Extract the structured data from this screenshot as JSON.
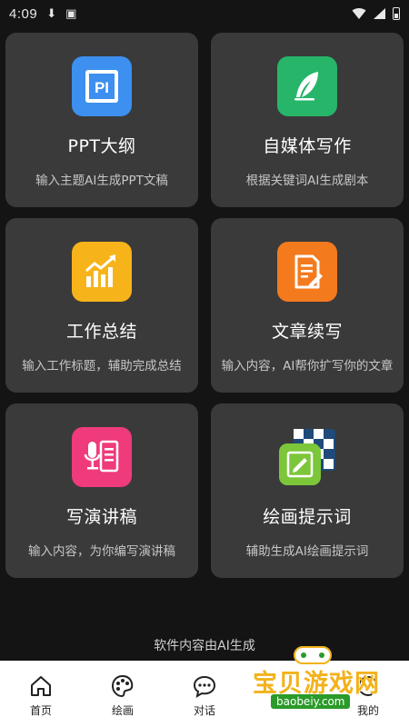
{
  "status_bar": {
    "time": "4:09"
  },
  "cards": [
    {
      "title": "PPT大纲",
      "subtitle": "输入主题AI生成PPT文稿",
      "icon": "ppt-icon",
      "color": "#3d8ff0"
    },
    {
      "title": "自媒体写作",
      "subtitle": "根据关键词AI生成剧本",
      "icon": "quill-icon",
      "color": "#27b56a"
    },
    {
      "title": "工作总结",
      "subtitle": "输入工作标题，辅助完成总结",
      "icon": "chart-icon",
      "color": "#f6b41a"
    },
    {
      "title": "文章续写",
      "subtitle": "输入内容，AI帮你扩写你的文章",
      "icon": "document-edit-icon",
      "color": "#f47a1e"
    },
    {
      "title": "写演讲稿",
      "subtitle": "输入内容，为你编写演讲稿",
      "icon": "microphone-icon",
      "color": "#ef3b7c"
    },
    {
      "title": "绘画提示词",
      "subtitle": "辅助生成AI绘画提示词",
      "icon": "painting-icon",
      "color": "#7cc63a"
    }
  ],
  "footer_note": "软件内容由AI生成",
  "bottom_nav": [
    {
      "label": "首页",
      "icon": "home-icon"
    },
    {
      "label": "绘画",
      "icon": "palette-icon"
    },
    {
      "label": "对话",
      "icon": "chat-icon"
    },
    {
      "label": "",
      "icon": "hidden-icon"
    },
    {
      "label": "我的",
      "icon": "profile-icon"
    }
  ],
  "watermark": {
    "text": "宝贝游戏网",
    "url": "baobeiy.com"
  }
}
